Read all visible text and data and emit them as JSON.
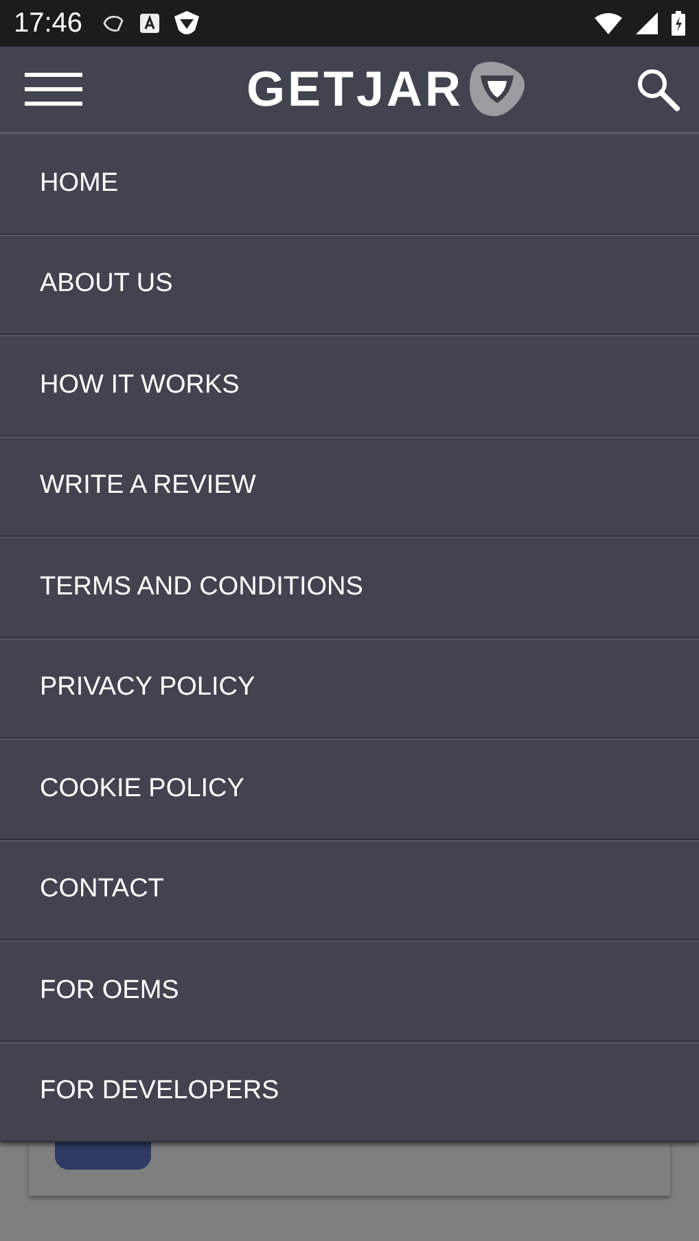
{
  "status_bar": {
    "time": "17:46"
  },
  "header": {
    "logo_text": "GETJAR"
  },
  "menu": {
    "items": [
      {
        "label": "HOME"
      },
      {
        "label": "ABOUT US"
      },
      {
        "label": "HOW IT WORKS"
      },
      {
        "label": "WRITE A REVIEW"
      },
      {
        "label": "TERMS AND CONDITIONS"
      },
      {
        "label": "PRIVACY POLICY"
      },
      {
        "label": "COOKIE POLICY"
      },
      {
        "label": "CONTACT"
      },
      {
        "label": "FOR OEMS"
      },
      {
        "label": "FOR DEVELOPERS"
      }
    ]
  }
}
